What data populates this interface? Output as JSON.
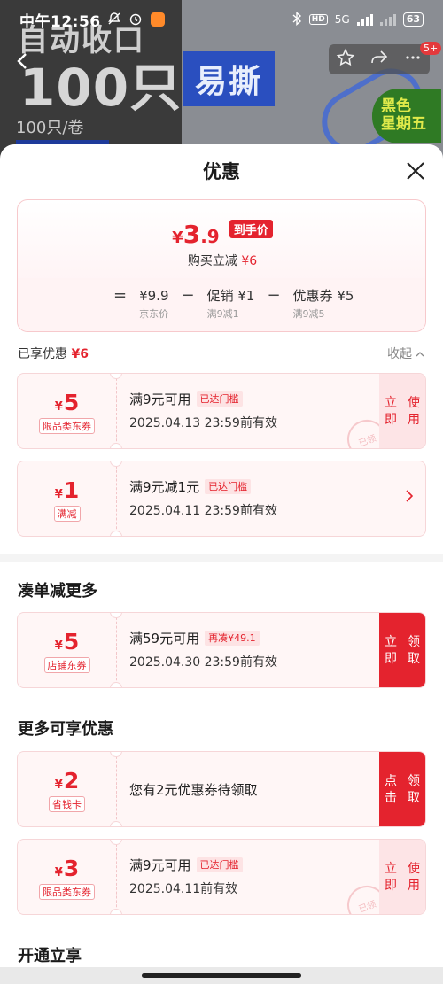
{
  "status": {
    "time": "中午12:56",
    "network": "5G",
    "battery": "63"
  },
  "background": {
    "line1": "自动收口",
    "line2": "100只",
    "sub": "100只/卷",
    "badge": "易撕",
    "promo": "黑色星期五",
    "cart_count": "5+"
  },
  "sheet": {
    "title": "优惠"
  },
  "summary": {
    "currency": "¥",
    "price_int": "3",
    "price_dec": ".9",
    "arrive_label": "到手价",
    "reduce_text": "购买立减",
    "reduce_amount": "¥6",
    "formula": {
      "eq": "=",
      "minus": "−",
      "items": [
        {
          "value": "¥9.9",
          "label": "京东价"
        },
        {
          "value": "促销 ¥1",
          "label": "满9减1"
        },
        {
          "value": "优惠券 ¥5",
          "label": "满9减5"
        }
      ]
    }
  },
  "enjoyed": {
    "label": "已享优惠",
    "amount": "¥6",
    "collapse": "收起"
  },
  "coupons": [
    {
      "currency": "¥",
      "amount": "5",
      "tag": "限品类东券",
      "title": "满9元可用",
      "badge": "已达门槛",
      "date": "2025.04.13 23:59前有效",
      "button": "立即使用",
      "stamp": "已领"
    },
    {
      "currency": "¥",
      "amount": "1",
      "tag": "满减",
      "title": "满9元减1元",
      "badge": "已达门槛",
      "date": "2025.04.11 23:59前有效"
    },
    {
      "currency": "¥",
      "amount": "5",
      "tag": "店铺东券",
      "title": "满59元可用",
      "badge": "再凑¥49.1",
      "date": "2025.04.30 23:59前有效",
      "button": "立即领取"
    },
    {
      "currency": "¥",
      "amount": "2",
      "tag": "省钱卡",
      "title": "您有2元优惠券待领取",
      "button": "点击领取"
    },
    {
      "currency": "¥",
      "amount": "3",
      "tag": "限品类东券",
      "title": "满9元可用",
      "badge": "已达门槛",
      "date": "2025.04.11前有效",
      "button": "立即使用",
      "stamp": "已领"
    }
  ],
  "sections": {
    "more_reduce": "凑单减更多",
    "more_offers": "更多可享优惠",
    "open_enjoy": "开通立享"
  },
  "colors": {
    "accent": "#e4232e"
  }
}
